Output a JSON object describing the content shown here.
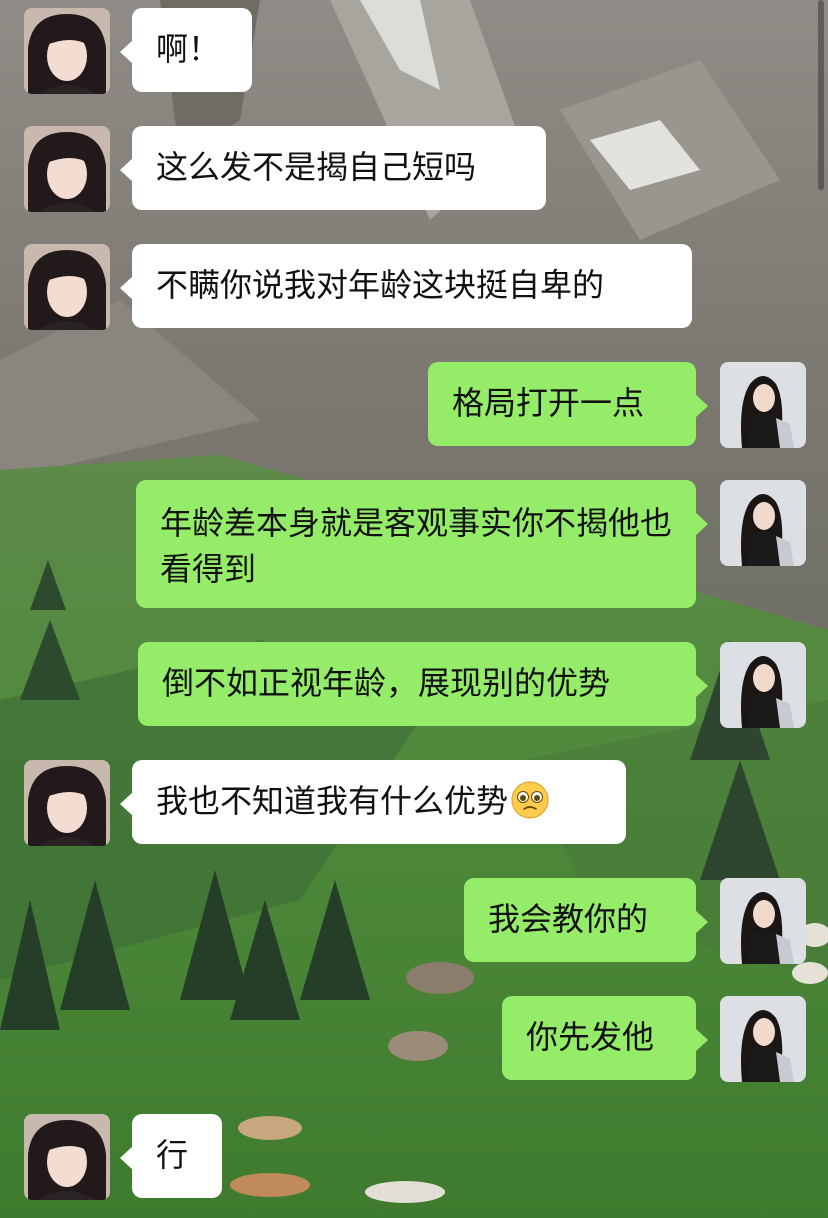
{
  "chat": {
    "messages": [
      {
        "side": "in",
        "text": "啊！"
      },
      {
        "side": "in",
        "text": "这么发不是揭自己短吗"
      },
      {
        "side": "in",
        "text": "不瞒你说我对年龄这块挺自卑的"
      },
      {
        "side": "out",
        "text": "格局打开一点"
      },
      {
        "side": "out",
        "text": "年龄差本身就是客观事实你不揭他也看得到"
      },
      {
        "side": "out",
        "text": "倒不如正视年龄，展现别的优势"
      },
      {
        "side": "in",
        "text": "我也不知道我有什么优势",
        "emoji": "pleading-face-emoji"
      },
      {
        "side": "out",
        "text": "我会教你的"
      },
      {
        "side": "out",
        "text": "你先发他"
      },
      {
        "side": "in",
        "text": "行"
      }
    ]
  },
  "colors": {
    "outgoing_bubble": "#95ec69",
    "incoming_bubble": "#ffffff"
  }
}
